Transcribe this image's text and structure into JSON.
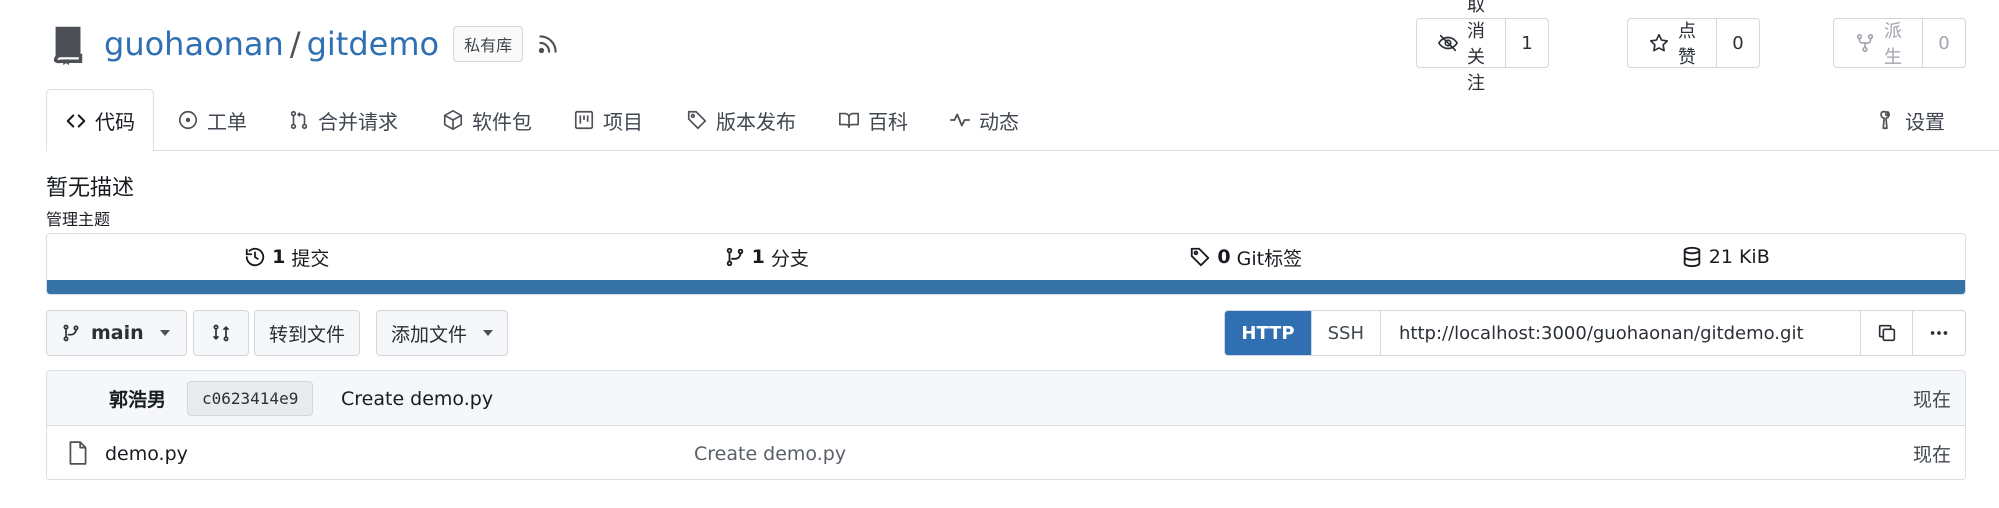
{
  "repo": {
    "owner": "guohaonan",
    "separator": "/",
    "name": "gitdemo",
    "visibility_badge": "私有库"
  },
  "header_actions": {
    "watch": {
      "label": "取消关注",
      "count": "1",
      "icon": "eye-slash-icon"
    },
    "star": {
      "label": "点赞",
      "count": "0",
      "icon": "star-icon"
    },
    "fork": {
      "label": "派生",
      "count": "0",
      "icon": "fork-icon",
      "disabled": true
    }
  },
  "tabs": [
    {
      "label": "代码",
      "icon": "code-icon",
      "active": true
    },
    {
      "label": "工单",
      "icon": "issue-icon"
    },
    {
      "label": "合并请求",
      "icon": "pull-request-icon"
    },
    {
      "label": "软件包",
      "icon": "package-icon"
    },
    {
      "label": "项目",
      "icon": "project-icon"
    },
    {
      "label": "版本发布",
      "icon": "tag-icon"
    },
    {
      "label": "百科",
      "icon": "book-icon"
    },
    {
      "label": "动态",
      "icon": "pulse-icon"
    }
  ],
  "settings_tab": {
    "label": "设置",
    "icon": "tools-icon"
  },
  "description": "暂无描述",
  "manage_topics": "管理主题",
  "stats": {
    "commits": {
      "count": "1",
      "label": "提交"
    },
    "branches": {
      "count": "1",
      "label": "分支"
    },
    "tags": {
      "count": "0",
      "label": "Git标签"
    },
    "size": {
      "value": "21 KiB"
    }
  },
  "language_bar_color": "#3572a5",
  "toolbar": {
    "branch": "main",
    "go_to_file": "转到文件",
    "add_file": "添加文件"
  },
  "clone": {
    "http_label": "HTTP",
    "ssh_label": "SSH",
    "url": "http://localhost:3000/guohaonan/gitdemo.git"
  },
  "latest_commit": {
    "author": "郭浩男",
    "sha": "c0623414e9",
    "message": "Create demo.py",
    "time": "现在"
  },
  "files": [
    {
      "name": "demo.py",
      "commit_message": "Create demo.py",
      "time": "现在"
    }
  ],
  "colors": {
    "accent": "#2f6fb2",
    "text": "#181c21",
    "border": "#d0d7de"
  }
}
